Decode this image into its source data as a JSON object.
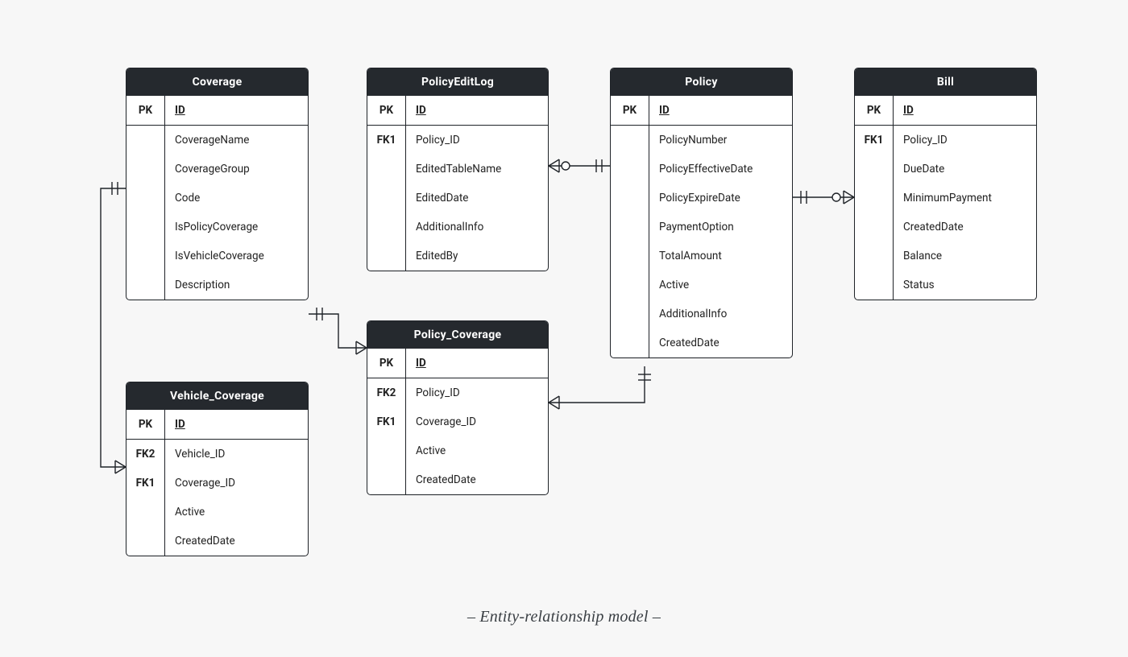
{
  "caption": "– Entity-relationship model –",
  "entities": {
    "coverage": {
      "title": "Coverage",
      "pk": {
        "key": "PK",
        "name": "ID"
      },
      "fields": [
        {
          "key": "",
          "name": "CoverageName"
        },
        {
          "key": "",
          "name": "CoverageGroup"
        },
        {
          "key": "",
          "name": "Code"
        },
        {
          "key": "",
          "name": "IsPolicyCoverage"
        },
        {
          "key": "",
          "name": "IsVehicleCoverage"
        },
        {
          "key": "",
          "name": "Description"
        }
      ]
    },
    "policyEditLog": {
      "title": "PolicyEditLog",
      "pk": {
        "key": "PK",
        "name": "ID"
      },
      "fields": [
        {
          "key": "FK1",
          "name": "Policy_ID"
        },
        {
          "key": "",
          "name": "EditedTableName"
        },
        {
          "key": "",
          "name": "EditedDate"
        },
        {
          "key": "",
          "name": "AdditionalInfo"
        },
        {
          "key": "",
          "name": "EditedBy"
        }
      ]
    },
    "policy": {
      "title": "Policy",
      "pk": {
        "key": "PK",
        "name": "ID"
      },
      "fields": [
        {
          "key": "",
          "name": "PolicyNumber"
        },
        {
          "key": "",
          "name": "PolicyEffectiveDate"
        },
        {
          "key": "",
          "name": "PolicyExpireDate"
        },
        {
          "key": "",
          "name": "PaymentOption"
        },
        {
          "key": "",
          "name": "TotalAmount"
        },
        {
          "key": "",
          "name": "Active"
        },
        {
          "key": "",
          "name": "AdditionalInfo"
        },
        {
          "key": "",
          "name": "CreatedDate"
        }
      ]
    },
    "bill": {
      "title": "Bill",
      "pk": {
        "key": "PK",
        "name": "ID"
      },
      "fields": [
        {
          "key": "FK1",
          "name": "Policy_ID"
        },
        {
          "key": "",
          "name": "DueDate"
        },
        {
          "key": "",
          "name": "MinimumPayment"
        },
        {
          "key": "",
          "name": "CreatedDate"
        },
        {
          "key": "",
          "name": "Balance"
        },
        {
          "key": "",
          "name": "Status"
        }
      ]
    },
    "policyCoverage": {
      "title": "Policy_Coverage",
      "pk": {
        "key": "PK",
        "name": "ID"
      },
      "fields": [
        {
          "key": "FK2",
          "name": "Policy_ID"
        },
        {
          "key": "FK1",
          "name": "Coverage_ID"
        },
        {
          "key": "",
          "name": "Active"
        },
        {
          "key": "",
          "name": "CreatedDate"
        }
      ]
    },
    "vehicleCoverage": {
      "title": "Vehicle_Coverage",
      "pk": {
        "key": "PK",
        "name": "ID"
      },
      "fields": [
        {
          "key": "FK2",
          "name": "Vehicle_ID"
        },
        {
          "key": "FK1",
          "name": "Coverage_ID"
        },
        {
          "key": "",
          "name": "Active"
        },
        {
          "key": "",
          "name": "CreatedDate"
        }
      ]
    }
  },
  "relationships": [
    {
      "from": "PolicyEditLog",
      "to": "Policy",
      "cardinality": "many-to-one"
    },
    {
      "from": "Bill",
      "to": "Policy",
      "cardinality": "many-to-one"
    },
    {
      "from": "Policy_Coverage",
      "to": "Policy",
      "cardinality": "many-to-one"
    },
    {
      "from": "Policy_Coverage",
      "to": "Coverage",
      "cardinality": "many-to-one"
    },
    {
      "from": "Vehicle_Coverage",
      "to": "Coverage",
      "cardinality": "many-to-one"
    }
  ]
}
